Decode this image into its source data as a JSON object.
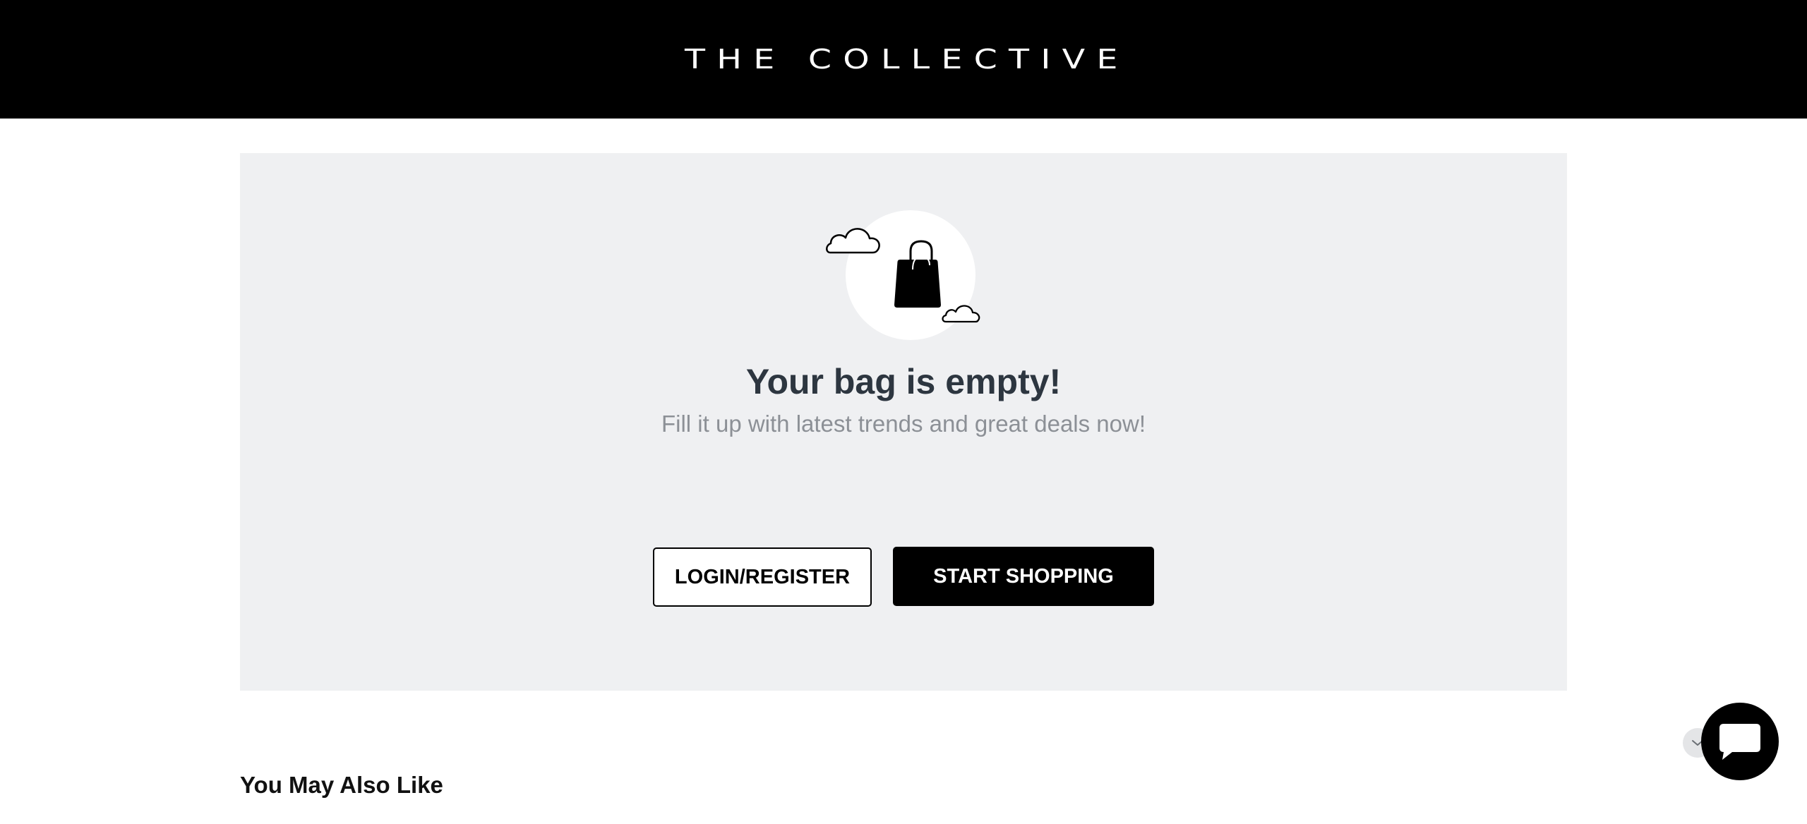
{
  "header": {
    "brand": "THE COLLECTIVE"
  },
  "empty_bag": {
    "illustration_icon": "shopping-bag-with-clouds-icon",
    "title": "Your bag is empty!",
    "subtitle": "Fill it up with latest trends and great deals now!",
    "login_button": "LOGIN/REGISTER",
    "shop_button": "START SHOPPING"
  },
  "recommendations": {
    "title": "You May Also Like"
  },
  "chat": {
    "collapse_icon": "chevron-down-icon",
    "launcher_icon": "chat-bubble-icon"
  },
  "colors": {
    "header_bg": "#000000",
    "panel_bg": "#eff0f2",
    "title_text": "#2d3640",
    "subtitle_text": "#8c9096",
    "primary_button": "#000000"
  }
}
